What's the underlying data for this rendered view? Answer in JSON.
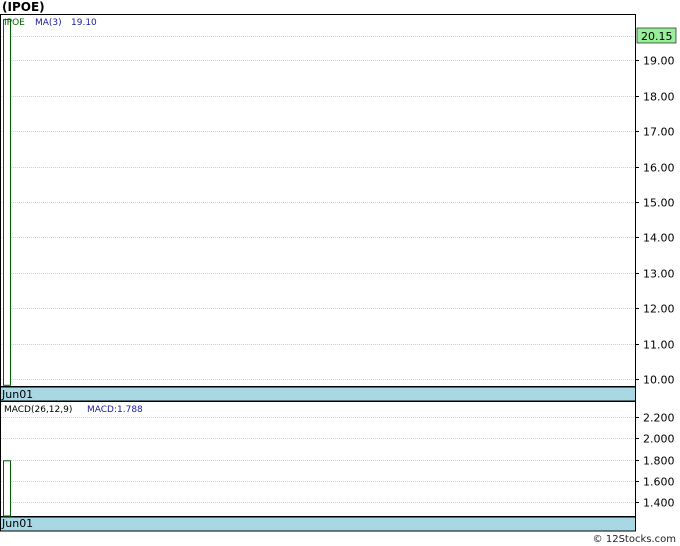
{
  "colors": {
    "grid": "#a0a0a0",
    "axis": "#000000",
    "price": "#006400",
    "ma": "#1a1aa0",
    "macd_label": "#000000",
    "macd_value": "#1a1aa0",
    "date_band": "#a8d8e4",
    "last_price_bg": "#99ee99",
    "watermark": "#222222"
  },
  "chart_data": [
    {
      "type": "bar",
      "title": "(IPOE)",
      "legend": {
        "symbol": "IPOE",
        "ma_label": "MA(3)",
        "ma_value": "19.10"
      },
      "last_price_label": "20.15",
      "ylim": [
        9.8,
        20.28
      ],
      "y_ticks": [
        "19.00",
        "18.00",
        "17.00",
        "16.00",
        "15.00",
        "14.00",
        "13.00",
        "12.00",
        "11.00",
        "10.00"
      ],
      "extra_gridlines": [
        19.7
      ],
      "x_tick_labels": [
        "Jun01"
      ],
      "bars": [
        {
          "x": "Jun01",
          "low": 9.82,
          "high": 20.15
        }
      ],
      "grid": true
    },
    {
      "type": "bar",
      "legend": {
        "name": "MACD(26,12,9)",
        "value_label": "MACD:1.788"
      },
      "ylim": [
        1.27,
        2.34
      ],
      "y_ticks": [
        "2.200",
        "2.000",
        "1.800",
        "1.600",
        "1.400"
      ],
      "x_tick_labels": [
        "Jun01"
      ],
      "bars": [
        {
          "x": "Jun01",
          "value": 1.788
        }
      ],
      "grid": true
    }
  ],
  "footer": {
    "watermark": "© 12Stocks.com"
  }
}
